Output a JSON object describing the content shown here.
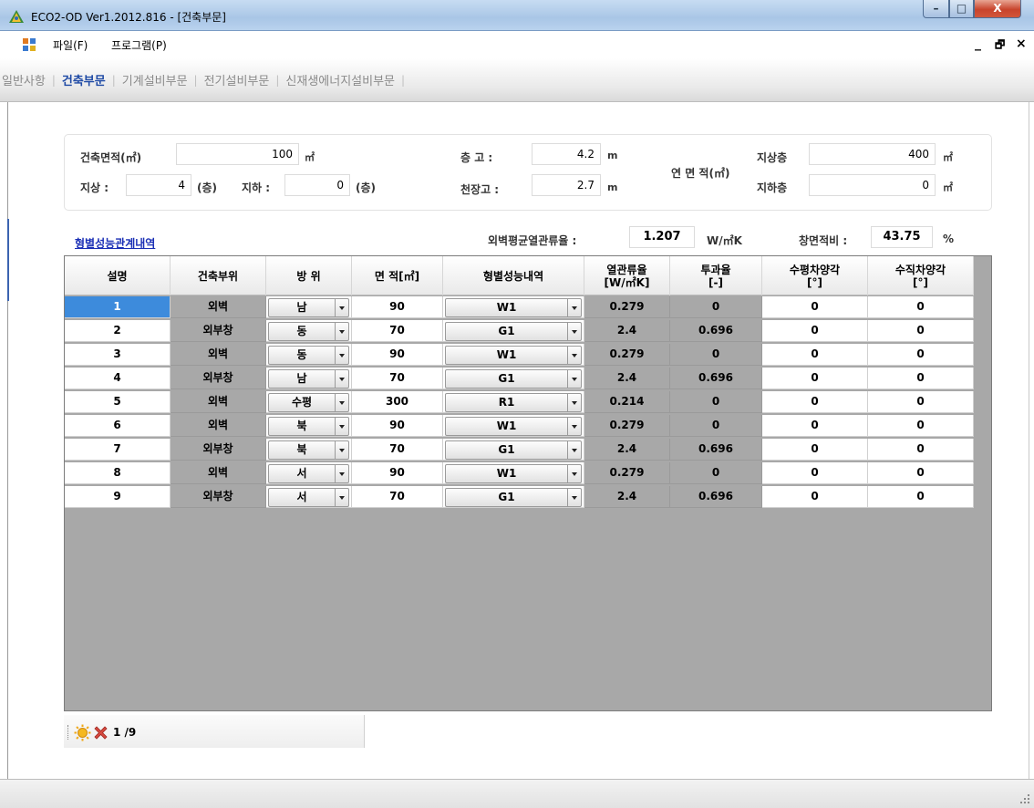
{
  "window": {
    "title": "ECO2-OD Ver1.2012.816 - [건축부문]",
    "minimize": "–",
    "maximize": "□",
    "close": "X"
  },
  "menu": {
    "items": [
      "파일(F)",
      "프로그램(P)"
    ],
    "mdi_min": "_",
    "mdi_restore": "🗗",
    "mdi_close": "×"
  },
  "nav": {
    "tabs": [
      "일반사항",
      "건축부문",
      "기계설비부문",
      "전기설비부문",
      "신재생에너지설비부문"
    ],
    "active": "건축부문"
  },
  "info": {
    "building_area_label": "건축면적(㎡)",
    "building_area": "100",
    "building_area_unit": "㎡",
    "above_label": "지상 :",
    "above_floors": "4",
    "above_unit": "(층)",
    "below_label": "지하 :",
    "below_floors": "0",
    "below_unit": "(층)",
    "floor_height_label": "층  고 :",
    "floor_height": "4.2",
    "floor_height_unit": "m",
    "ceiling_height_label": "천장고 :",
    "ceiling_height": "2.7",
    "ceiling_height_unit": "m",
    "total_area_label": "연 면 적(㎡)",
    "above_area_label": "지상층",
    "above_area": "400",
    "above_area_unit": "㎡",
    "below_area_label": "지하층",
    "below_area": "0",
    "below_area_unit": "㎡"
  },
  "summary": {
    "link": "형별성능관계내역",
    "wall_u_label": "외벽평균열관류율 :",
    "wall_u": "1.207",
    "wall_u_unit": "W/㎡K",
    "window_ratio_label": "창면적비 :",
    "window_ratio": "43.75",
    "window_ratio_unit": "%"
  },
  "table": {
    "headers": [
      "설명",
      "건축부위",
      "방  위",
      "면  적[㎡]",
      "형별성능내역",
      "열관류율\n[W/㎡K]",
      "투과율\n[-]",
      "수평차양각\n[°]",
      "수직차양각\n[°]"
    ],
    "rows": [
      [
        "1",
        "외벽",
        "남",
        "90",
        "W1",
        "0.279",
        "0",
        "0",
        "0"
      ],
      [
        "2",
        "외부창",
        "동",
        "70",
        "G1",
        "2.4",
        "0.696",
        "0",
        "0"
      ],
      [
        "3",
        "외벽",
        "동",
        "90",
        "W1",
        "0.279",
        "0",
        "0",
        "0"
      ],
      [
        "4",
        "외부창",
        "남",
        "70",
        "G1",
        "2.4",
        "0.696",
        "0",
        "0"
      ],
      [
        "5",
        "외벽",
        "수평",
        "300",
        "R1",
        "0.214",
        "0",
        "0",
        "0"
      ],
      [
        "6",
        "외벽",
        "북",
        "90",
        "W1",
        "0.279",
        "0",
        "0",
        "0"
      ],
      [
        "7",
        "외부창",
        "북",
        "70",
        "G1",
        "2.4",
        "0.696",
        "0",
        "0"
      ],
      [
        "8",
        "외벽",
        "서",
        "90",
        "W1",
        "0.279",
        "0",
        "0",
        "0"
      ],
      [
        "9",
        "외부창",
        "서",
        "70",
        "G1",
        "2.4",
        "0.696",
        "0",
        "0"
      ]
    ],
    "selected_row": 0
  },
  "navigator": {
    "position": "1 /9"
  },
  "colors": {
    "accent": "#1f4aa5",
    "selection": "#3d8bdc",
    "grid_bg": "#a8a8a8"
  },
  "icons": {
    "app": "app-logo-icon",
    "menu": "window-menu-icon",
    "add": "sun-add-icon",
    "delete": "red-x-delete-icon"
  }
}
